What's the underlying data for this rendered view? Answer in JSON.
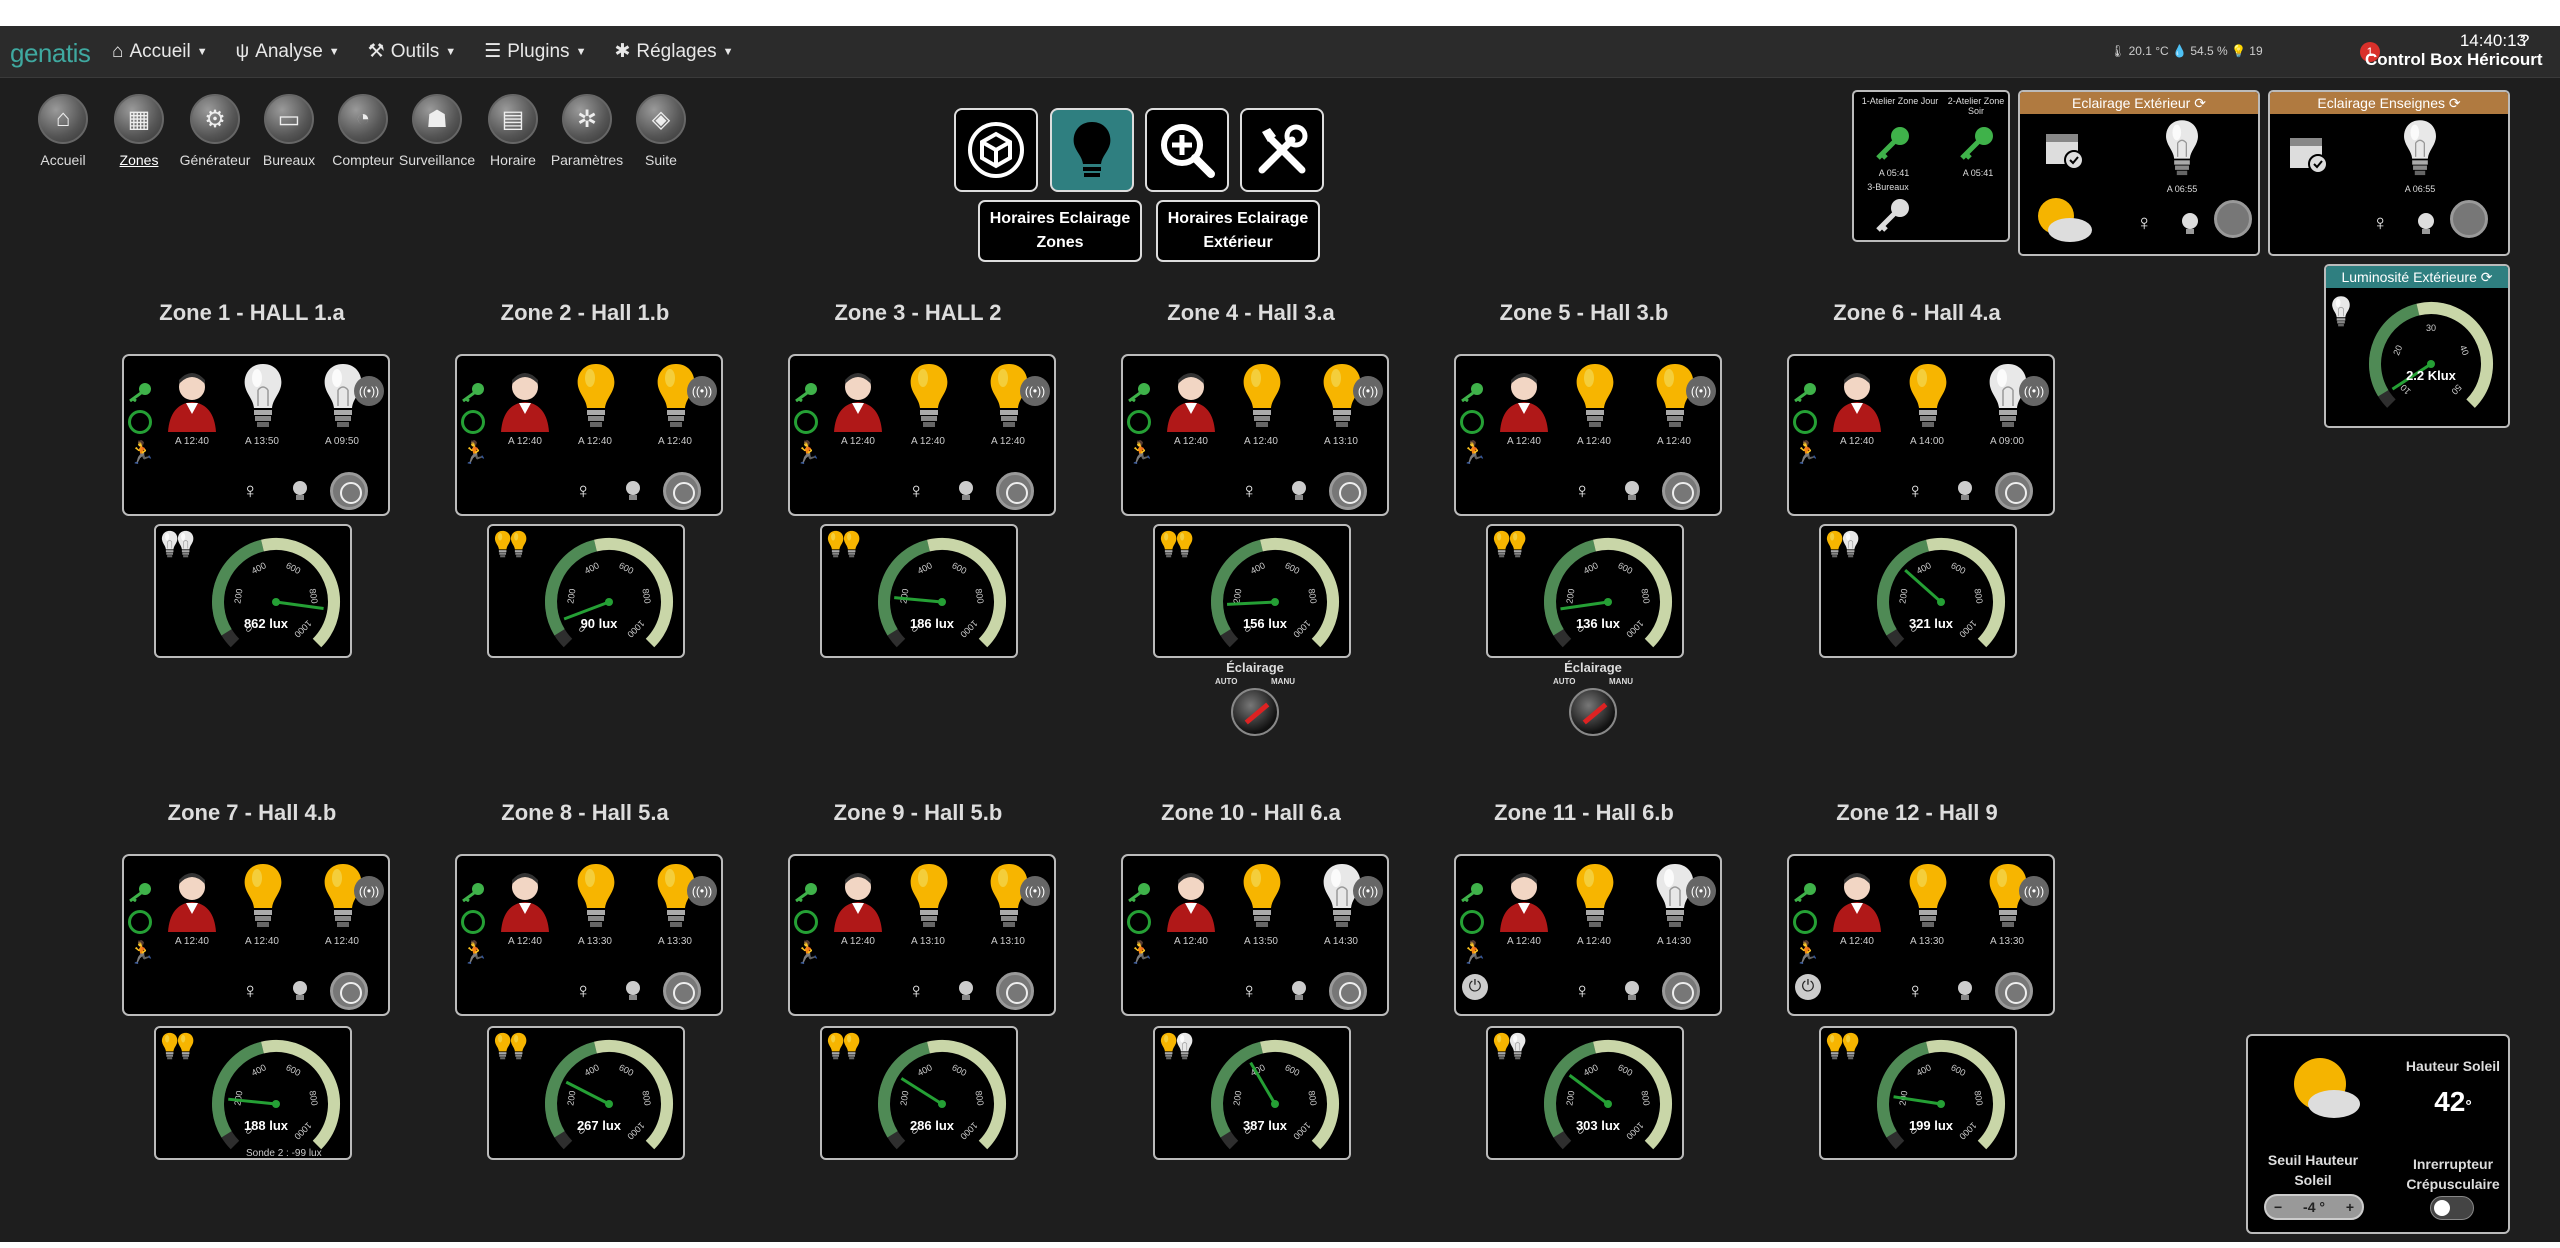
{
  "brand": "genatis",
  "nav": [
    {
      "icon": "home-icon",
      "glyph": "⌂",
      "label": "Accueil"
    },
    {
      "icon": "stethoscope-icon",
      "glyph": "ψ",
      "label": "Analyse"
    },
    {
      "icon": "wrench-icon",
      "glyph": "⚒",
      "label": "Outils"
    },
    {
      "icon": "list-icon",
      "glyph": "☰",
      "label": "Plugins"
    },
    {
      "icon": "gear-icon",
      "glyph": "✱",
      "label": "Réglages"
    }
  ],
  "sensors": "🌡 20.1 °C  💧 54.5 %  💡 19",
  "clock": "14:40:13",
  "box_name": "Control Box Héricourt",
  "notif": "1",
  "help": "?",
  "shortcuts": [
    {
      "label": "Accueil",
      "glyph": "⌂",
      "icon": "home-icon",
      "active": false
    },
    {
      "label": "Zones",
      "glyph": "▦",
      "icon": "zones-icon",
      "active": true
    },
    {
      "label": "Générateur",
      "glyph": "⚙",
      "icon": "generator-icon",
      "active": false
    },
    {
      "label": "Bureaux",
      "glyph": "▭",
      "icon": "office-icon",
      "active": false
    },
    {
      "label": "Compteur",
      "glyph": "◔",
      "icon": "meter-icon",
      "active": false
    },
    {
      "label": "Surveillance",
      "glyph": "☗",
      "icon": "camera-icon",
      "active": false
    },
    {
      "label": "Horaire",
      "glyph": "▤",
      "icon": "calendar-icon",
      "active": false
    },
    {
      "label": "Paramètres",
      "glyph": "✲",
      "icon": "settings-icon",
      "active": false
    },
    {
      "label": "Suite",
      "glyph": "◈",
      "icon": "box-icon",
      "active": false
    }
  ],
  "center": {
    "btn_horaires_zones": "Horaires Eclairage Zones",
    "btn_horaires_ext": "Horaires Eclairage Extérieur"
  },
  "colors": {
    "accent": "#2f7f80",
    "bulb_on": "#f7b500",
    "bulb_off": "#e8e8e8",
    "person": "#b01818",
    "green": "#25a035"
  },
  "zones": [
    {
      "title": "Zone 1 - HALL 1.a",
      "t": [
        "A 12:40",
        "A 13:50",
        "A 09:50"
      ],
      "b1": false,
      "b2": false,
      "lux": "862 lux",
      "luxval": 862,
      "mini": [
        false,
        false
      ]
    },
    {
      "title": "Zone 2 - Hall 1.b",
      "t": [
        "A 12:40",
        "A 12:40",
        "A 12:40"
      ],
      "b1": true,
      "b2": true,
      "lux": "90 lux",
      "luxval": 90,
      "mini": [
        true,
        true
      ]
    },
    {
      "title": "Zone 3 - HALL 2",
      "t": [
        "A 12:40",
        "A 12:40",
        "A 12:40"
      ],
      "b1": true,
      "b2": true,
      "lux": "186 lux",
      "luxval": 186,
      "mini": [
        true,
        true
      ]
    },
    {
      "title": "Zone 4 - Hall 3.a",
      "t": [
        "A 12:40",
        "A 12:40",
        "A 13:10"
      ],
      "b1": true,
      "b2": true,
      "lux": "156 lux",
      "luxval": 156,
      "mini": [
        true,
        true
      ]
    },
    {
      "title": "Zone 5 - Hall 3.b",
      "t": [
        "A 12:40",
        "A 12:40",
        "A 12:40"
      ],
      "b1": true,
      "b2": true,
      "lux": "136 lux",
      "luxval": 136,
      "mini": [
        true,
        true
      ]
    },
    {
      "title": "Zone 6 - Hall 4.a",
      "t": [
        "A 12:40",
        "A 14:00",
        "A 09:00"
      ],
      "b1": true,
      "b2": false,
      "lux": "321 lux",
      "luxval": 321,
      "mini": [
        true,
        false
      ]
    },
    {
      "title": "Zone 7 - Hall 4.b",
      "t": [
        "A 12:40",
        "A 12:40",
        "A 12:40"
      ],
      "b1": true,
      "b2": true,
      "lux": "188 lux",
      "luxval": 188,
      "mini": [
        true,
        true
      ],
      "sub": "Sonde 2 : -99 lux"
    },
    {
      "title": "Zone 8 - Hall 5.a",
      "t": [
        "A 12:40",
        "A 13:30",
        "A 13:30"
      ],
      "b1": true,
      "b2": true,
      "lux": "267 lux",
      "luxval": 267,
      "mini": [
        true,
        true
      ]
    },
    {
      "title": "Zone 9 - Hall 5.b",
      "t": [
        "A 12:40",
        "A 13:10",
        "A 13:10"
      ],
      "b1": true,
      "b2": true,
      "lux": "286 lux",
      "luxval": 286,
      "mini": [
        true,
        true
      ]
    },
    {
      "title": "Zone 10 - Hall 6.a",
      "t": [
        "A 12:40",
        "A 13:50",
        "A 14:30"
      ],
      "b1": true,
      "b2": false,
      "lux": "387 lux",
      "luxval": 387,
      "mini": [
        true,
        false
      ]
    },
    {
      "title": "Zone 11 - Hall 6.b",
      "t": [
        "A 12:40",
        "A 12:40",
        "A 14:30"
      ],
      "b1": true,
      "b2": false,
      "lux": "303 lux",
      "luxval": 303,
      "mini": [
        true,
        false
      ],
      "power": true
    },
    {
      "title": "Zone 12 - Hall 9",
      "t": [
        "A 12:40",
        "A 13:30",
        "A 13:30"
      ],
      "b1": true,
      "b2": true,
      "lux": "199 lux",
      "luxval": 199,
      "mini": [
        true,
        true
      ],
      "power": true
    }
  ],
  "gauge_ticks": [
    "0",
    "200",
    "400",
    "600",
    "800",
    "1000"
  ],
  "switch": {
    "title": "Éclairage",
    "auto": "AUTO",
    "manu": "MANU"
  },
  "keys_widget": {
    "a": "1-Atelier Zone Jour",
    "b": "2-Atelier Zone Soir",
    "c": "3-Bureaux",
    "ta": "A 05:41",
    "tb": "A 05:41"
  },
  "ext_widget": {
    "title": "Eclairage Extérieur",
    "time": "A 06:55"
  },
  "ens_widget": {
    "title": "Eclairage Enseignes",
    "time": "A 06:55"
  },
  "lumi_widget": {
    "title": "Luminosité Extérieure",
    "value": "2.2 Klux",
    "ticks": [
      "10",
      "20",
      "30",
      "40",
      "50"
    ]
  },
  "sun": {
    "hauteur_label": "Hauteur Soleil",
    "hauteur_value": "42",
    "deg": "°",
    "seuil_label": "Seuil Hauteur Soleil",
    "seuil_value": "-4 °",
    "minus": "−",
    "plus": "+",
    "interrupteur_label": "Inrerrupteur Crépusculaire"
  }
}
